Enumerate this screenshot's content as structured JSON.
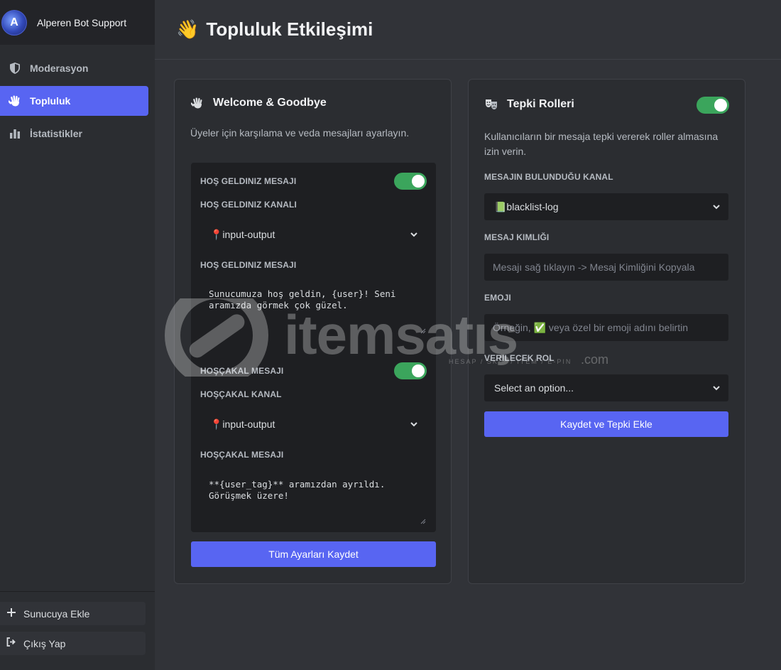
{
  "sidebar": {
    "bot_name": "Alperen Bot Support",
    "avatar_letter": "A",
    "items": [
      {
        "label": "Moderasyon",
        "icon": "shield-icon"
      },
      {
        "label": "Topluluk",
        "icon": "waving-hand-icon",
        "active": true
      },
      {
        "label": "İstatistikler",
        "icon": "bar-chart-icon"
      }
    ],
    "bottom": {
      "add_server_label": "Sunucuya Ekle",
      "logout_label": "Çıkış Yap"
    }
  },
  "header": {
    "emoji": "👋",
    "title": "Topluluk Etkileşimi"
  },
  "welcome_card": {
    "title": "Welcome & Goodbye",
    "description": "Üyeler için karşılama ve veda mesajları ayarlayın.",
    "welcome_toggle_label": "HOŞ GELDINIZ MESAJI",
    "welcome_enabled": true,
    "welcome_channel_label": "HOŞ GELDINIZ KANALI",
    "welcome_channel_value": "📍input-output",
    "welcome_message_label": "HOŞ GELDINIZ MESAJI",
    "welcome_message_value": "Sunucumuza hoş geldin, {user}! Seni aramızda görmek çok güzel.",
    "goodbye_toggle_label": "HOŞÇAKAL MESAJI",
    "goodbye_enabled": true,
    "goodbye_channel_label": "HOŞÇAKAL KANAL",
    "goodbye_channel_value": "📍input-output",
    "goodbye_message_label": "HOŞÇAKAL MESAJI",
    "goodbye_message_value": "**{user_tag}** aramızdan ayrıldı. Görüşmek üzere!",
    "save_label": "Tüm Ayarları Kaydet"
  },
  "reaction_card": {
    "title": "Tepki Rolleri",
    "enabled": true,
    "description": "Kullanıcıların bir mesaja tepki vererek roller almasına izin verin.",
    "channel_label": "MESAJIN BULUNDUĞU KANAL",
    "channel_value": "📗blacklist-log",
    "message_id_label": "MESAJ KIMLIĞI",
    "message_id_placeholder": "Mesajı sağ tıklayın -> Mesaj Kimliğini Kopyala",
    "emoji_label": "EMOJI",
    "emoji_placeholder": "Örneğin, ✅ veya özel bir emoji adını belirtin",
    "role_label": "VERILECEK ROL",
    "role_value": "Select an option...",
    "submit_label": "Kaydet ve Tepki Ekle"
  },
  "watermark": {
    "text": "itemsatış",
    "tagline": "HESAP / SKIN / ITEM / E-PIN",
    "suffix": ".com"
  },
  "colors": {
    "accent": "#5865f2",
    "toggle_on": "#3ba55c",
    "background": "#313338",
    "card": "#2b2d31",
    "input": "#1e1f22"
  }
}
